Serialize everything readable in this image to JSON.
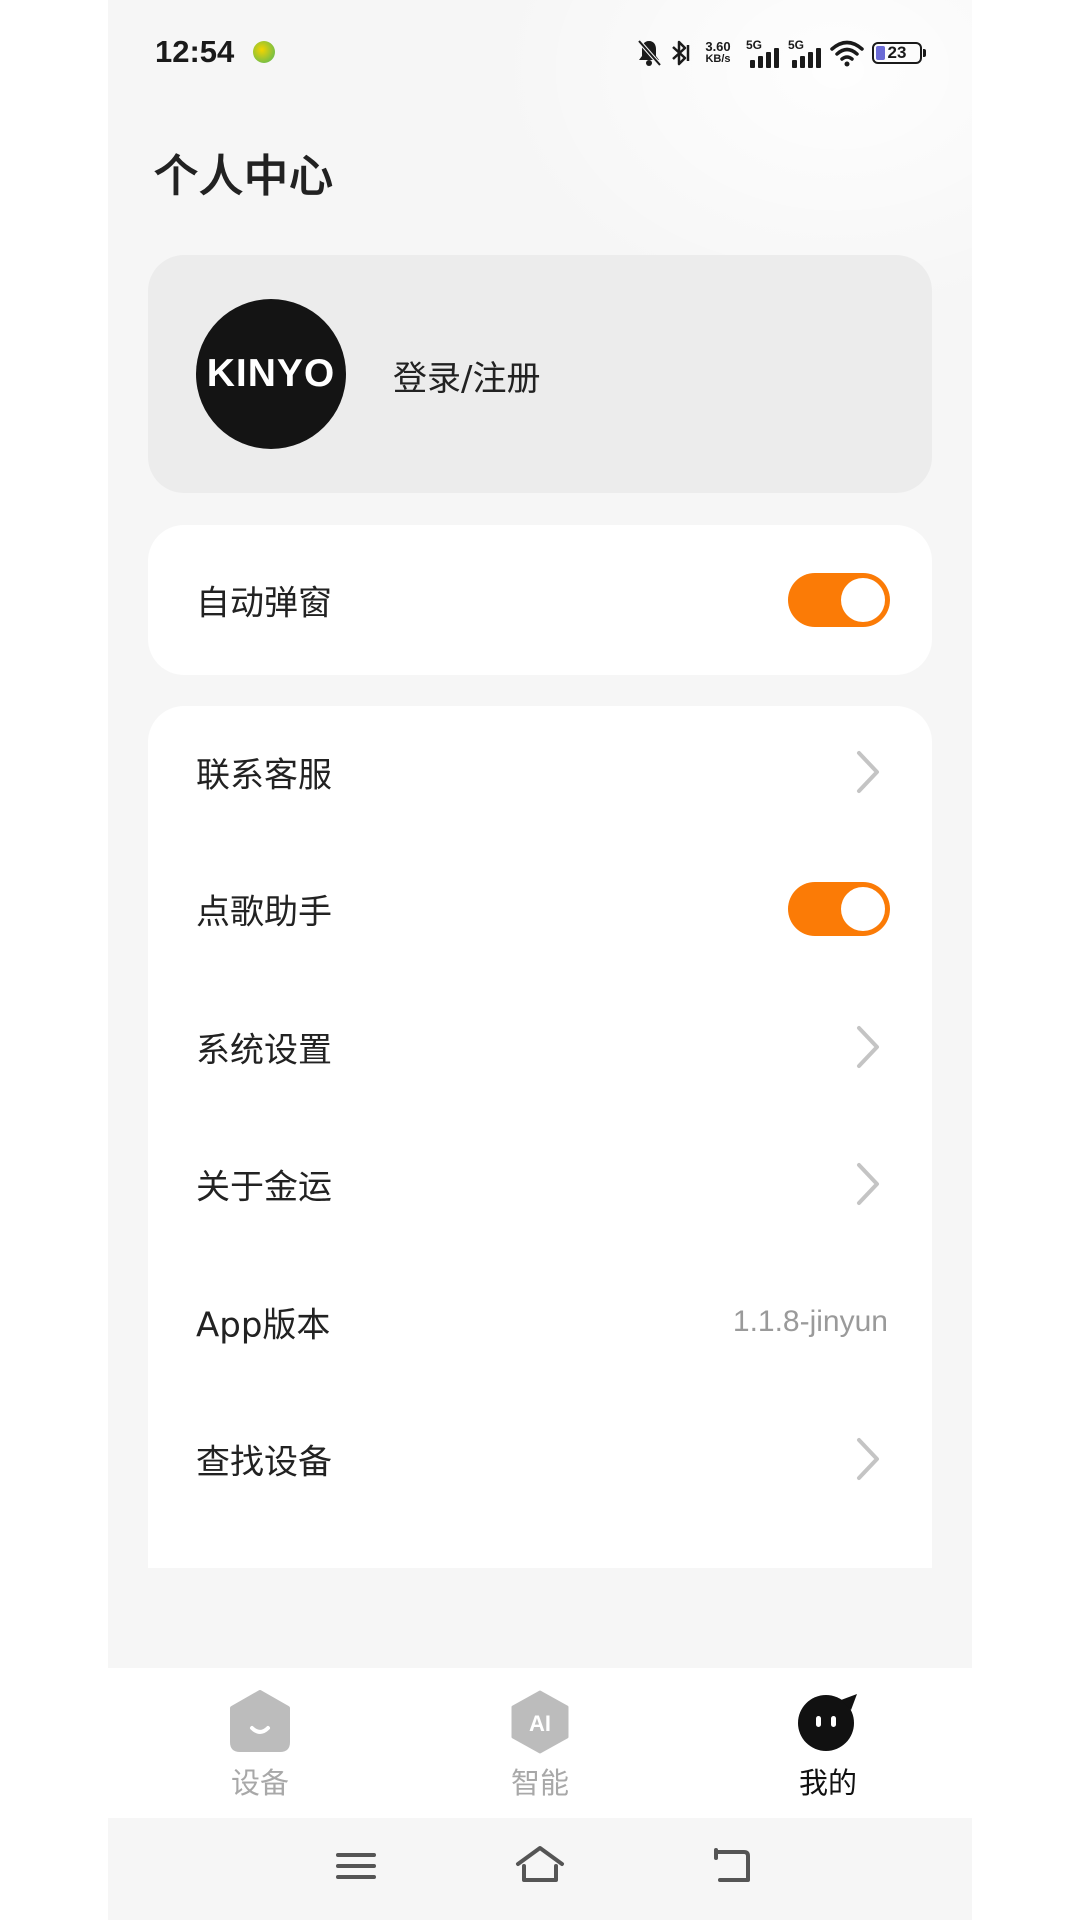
{
  "status_bar": {
    "time": "12:54",
    "net_speed_value": "3.60",
    "net_speed_unit": "KB/s",
    "sim1_label": "5G",
    "sim2_label": "5G",
    "battery_level": "23"
  },
  "header": {
    "title": "个人中心"
  },
  "profile": {
    "avatar_logo_text": "KINYO",
    "login_label": "登录/注册"
  },
  "settings": {
    "auto_popup": {
      "label": "自动弹窗",
      "enabled": true
    },
    "items": [
      {
        "label": "联系客服",
        "control": "chevron"
      },
      {
        "label": "点歌助手",
        "control": "toggle",
        "enabled": true
      },
      {
        "label": "系统设置",
        "control": "chevron"
      },
      {
        "label": "关于金运",
        "control": "chevron"
      },
      {
        "label": "App版本",
        "control": "value",
        "value": "1.1.8-jinyun"
      },
      {
        "label": "查找设备",
        "control": "chevron"
      }
    ]
  },
  "tab_bar": {
    "tabs": [
      {
        "label": "设备",
        "icon": "device-icon",
        "active": false
      },
      {
        "label": "智能",
        "icon": "ai-icon",
        "active": false
      },
      {
        "label": "我的",
        "icon": "mine-icon",
        "active": true
      }
    ]
  },
  "nav_bar": {
    "buttons": [
      "menu-icon",
      "home-icon",
      "back-icon"
    ]
  },
  "colors": {
    "accent": "#fb7b06",
    "background": "#f6f6f6",
    "card": "#ffffff",
    "login_card": "#ececec",
    "inactive_tab": "#a8a8a8"
  }
}
